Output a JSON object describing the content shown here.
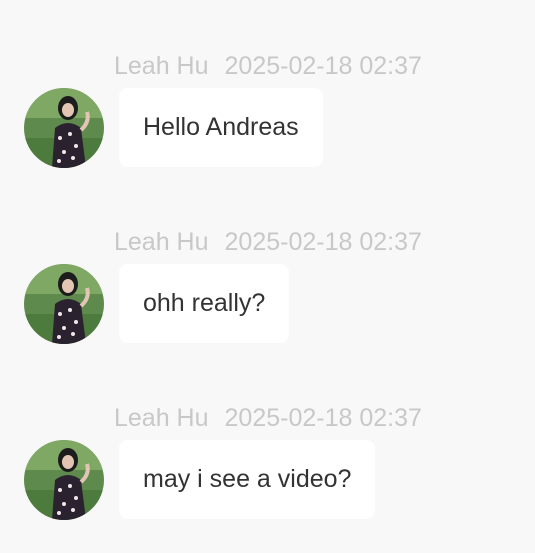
{
  "colors": {
    "background": "#f8f8f8",
    "meta_text": "#c8c8c8",
    "bubble_bg": "#ffffff",
    "message_text": "#333333"
  },
  "messages": [
    {
      "sender": "Leah Hu",
      "timestamp": "2025-02-18 02:37",
      "text": "Hello Andreas",
      "avatar_icon": "user-avatar-photo"
    },
    {
      "sender": "Leah Hu",
      "timestamp": "2025-02-18 02:37",
      "text": "ohh really?",
      "avatar_icon": "user-avatar-photo"
    },
    {
      "sender": "Leah Hu",
      "timestamp": "2025-02-18 02:37",
      "text": "may i see a video?",
      "avatar_icon": "user-avatar-photo"
    }
  ]
}
